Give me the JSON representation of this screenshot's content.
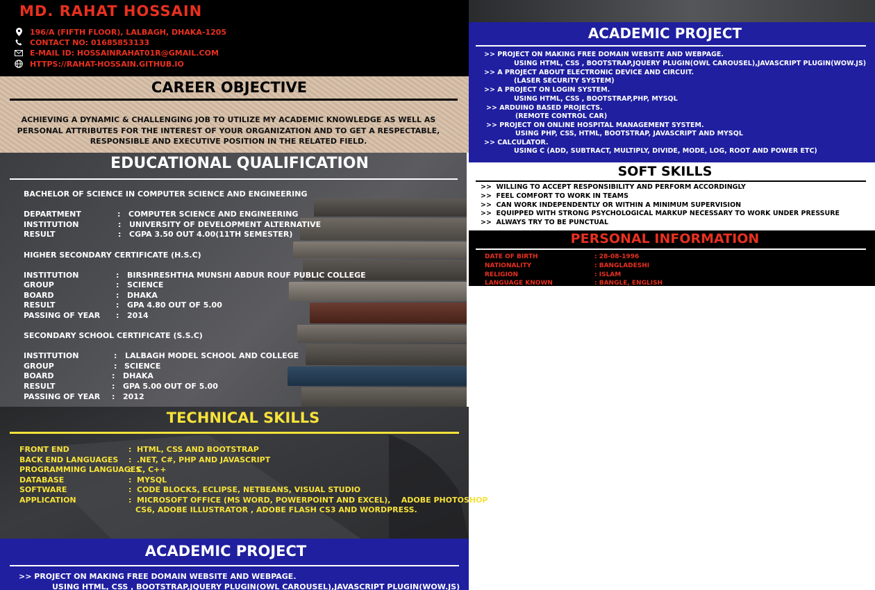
{
  "header": {
    "name": "MD. RAHAT HOSSAIN",
    "contacts": [
      {
        "icon": "location-pin-icon",
        "text": "196/A (FIFTH FLOOR), LALBAGH, DHAKA-1205"
      },
      {
        "icon": "phone-icon",
        "text": "CONTACT NO: 01685853133"
      },
      {
        "icon": "email-icon",
        "text": "E-MAIL ID: HOSSAINRAHAT01R@GMAIL.COM"
      },
      {
        "icon": "globe-icon",
        "text": "HTTPS://RAHAT-HOSSAIN.GITHUB.IO"
      }
    ]
  },
  "career": {
    "title": "CAREER OBJECTIVE",
    "text": "ACHIEVING A DYNAMIC & CHALLENGING JOB TO UTILIZE MY ACADEMIC KNOWLEDGE AS WELL AS PERSONAL ATTRIBUTES FOR THE INTEREST OF YOUR ORGANIZATION AND TO GET A RESPECTABLE, RESPONSIBLE AND EXECUTIVE POSITION IN THE RELATED FIELD."
  },
  "education": {
    "title": "EDUCATIONAL QUALIFICATION",
    "degrees": [
      {
        "heading": "BACHELOR OF SCIENCE IN COMPUTER SCIENCE AND ENGINEERING",
        "rows": [
          {
            "label": "DEPARTMENT",
            "value": "COMPUTER SCIENCE AND ENGINEERING"
          },
          {
            "label": "INSTITUTION",
            "value": "UNIVERSITY OF DEVELOPMENT ALTERNATIVE"
          },
          {
            "label": "RESULT",
            "value": "CGPA 3.50 OUT 4.00(11TH SEMESTER)"
          }
        ]
      },
      {
        "heading": "HIGHER SECONDARY CERTIFICATE (H.S.C)",
        "rows": [
          {
            "label": "INSTITUTION",
            "value": "BIRSHRESHTHA MUNSHI ABDUR ROUF PUBLIC COLLEGE"
          },
          {
            "label": "GROUP",
            "value": "SCIENCE"
          },
          {
            "label": "BOARD",
            "value": "DHAKA"
          },
          {
            "label": "RESULT",
            "value": "GPA 4.80 OUT OF 5.00"
          },
          {
            "label": "PASSING OF YEAR",
            "value": "2014"
          }
        ]
      },
      {
        "heading": "SECONDARY SCHOOL CERTIFICATE (S.S.C)",
        "rows": [
          {
            "label": "INSTITUTION",
            "value": "LALBAGH MODEL SCHOOL AND COLLEGE"
          },
          {
            "label": "GROUP",
            "value": "SCIENCE"
          },
          {
            "label": "BOARD",
            "value": "DHAKA"
          },
          {
            "label": "RESULT",
            "value": "GPA 5.00 OUT OF 5.00"
          },
          {
            "label": "PASSING OF YEAR",
            "value": "2012"
          }
        ]
      }
    ]
  },
  "technical": {
    "title": "TECHNICAL SKILLS",
    "rows": [
      {
        "label": "FRONT END",
        "value": "HTML, CSS AND BOOTSTRAP"
      },
      {
        "label": "BACK END LANGUAGES",
        "value": ".NET, C#, PHP AND JAVASCRIPT"
      },
      {
        "label": "PROGRAMMING LANGUAGES",
        "value": "C, C++"
      },
      {
        "label": "DATABASE",
        "value": "MYSQL"
      },
      {
        "label": "SOFTWARE",
        "value": "CODE BLOCKS, ECLIPSE, NETBEANS, VISUAL STUDIO"
      },
      {
        "label": "APPLICATION",
        "value": "MICROSOFT OFFICE (MS WORD, POWERPOINT AND EXCEL),    ADOBE PHOTOSHOP",
        "value2": "CS6, ADOBE ILLUSTRATOR , ADOBE FLASH CS3 AND WORDPRESS."
      }
    ]
  },
  "academic": {
    "title": "ACADEMIC PROJECT",
    "items": [
      {
        "title": ">> PROJECT ON MAKING FREE DOMAIN WEBSITE AND WEBPAGE.",
        "detail": "USING HTML, CSS , BOOTSTRAP,JQUERY PLUGIN(OWL CAROUSEL),JAVASCRIPT PLUGIN(WOW.JS)"
      },
      {
        "title": ">> A PROJECT ABOUT ELECTRONIC DEVICE AND CIRCUIT.",
        "detail": "(LASER SECURITY SYSTEM)"
      },
      {
        "title": ">> A PROJECT ON LOGIN SYSTEM.",
        "detail": "USING HTML, CSS , BOOTSTRAP,PHP, MYSQL"
      },
      {
        "title": ">> ARDUINO BASED PROJECTS.",
        "detail": "(REMOTE CONTROL CAR)"
      },
      {
        "title": ">> PROJECT ON ONLINE HOSPITAL MANAGEMENT SYSTEM.",
        "detail": "USING PHP, CSS, HTML, BOOTSTRAP, JAVASCRIPT AND MYSQL"
      },
      {
        "title": ">> CALCULATOR.",
        "detail": "USING C (ADD, SUBTRACT, MULTIPLY, DIVIDE, MODE, LOG, ROOT AND POWER ETC)"
      }
    ]
  },
  "soft": {
    "title": "SOFT SKILLS",
    "items": [
      ">>  WILLING TO ACCEPT RESPONSIBILITY AND PERFORM ACCORDINGLY",
      ">>  FEEL COMFORT TO WORK IN TEAMS",
      ">>  CAN WORK INDEPENDENTLY OR WITHIN A MINIMUM SUPERVISION",
      ">>  EQUIPPED WITH STRONG PSYCHOLOGICAL MARKUP NECESSARY TO WORK UNDER PRESSURE",
      ">>  ALWAYS TRY TO BE PUNCTUAL"
    ]
  },
  "personal": {
    "title": "PERSONAL INFORMATION",
    "rows": [
      {
        "label": "DATE OF BIRTH",
        "value": ": 28-08-1996"
      },
      {
        "label": "NATIONALITY",
        "value": ": BANGLADESHI"
      },
      {
        "label": "RELIGION",
        "value": ": ISLAM"
      },
      {
        "label": "LANGUAGE KNOWN",
        "value": ": BANGLE, ENGLISH"
      }
    ]
  },
  "colors": {
    "accent_red": "#e8301f",
    "skill_yellow": "#f6e23a",
    "project_blue": "#1f1fa0"
  }
}
